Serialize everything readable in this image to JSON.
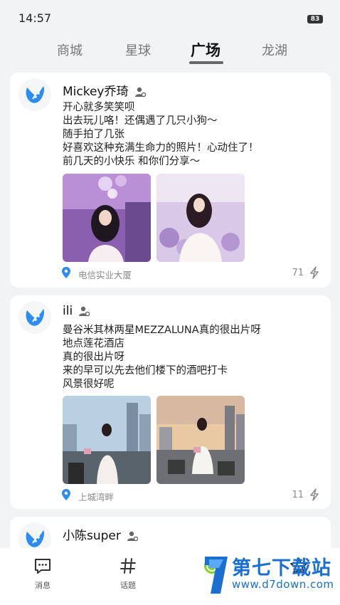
{
  "status_bar": {
    "time": "14:57",
    "battery": "83"
  },
  "tabs": [
    {
      "label": "商城",
      "active": false
    },
    {
      "label": "星球",
      "active": false
    },
    {
      "label": "广场",
      "active": true
    },
    {
      "label": "龙湖",
      "active": false
    }
  ],
  "posts": [
    {
      "username": "Mickey乔琦",
      "lines": [
        "开心就多笑笑呗",
        "出去玩儿咯！还偶遇了几只小狗～",
        "随手拍了几张",
        "好喜欢这种充满生命力的照片！心动住了！",
        "前几天的小快乐 和你们分享～"
      ],
      "location": "电信实业大厦",
      "likes": "71"
    },
    {
      "username": "ili",
      "lines": [
        "曼谷米其林两星MEZZALUNA真的很出片呀",
        "地点莲花酒店",
        "真的很出片呀",
        "来的早可以先去他们楼下的酒吧打卡",
        "风景很好呢"
      ],
      "location": "上城湾畔",
      "likes": "11"
    },
    {
      "username": "小陈super"
    }
  ],
  "bottom_nav": [
    {
      "label": "消息",
      "icon": "message-icon"
    },
    {
      "label": "话题",
      "icon": "hashtag-icon"
    },
    {
      "label": "",
      "icon": "swirl-icon"
    },
    {
      "label": "",
      "icon": "star-face-icon"
    }
  ],
  "watermark": {
    "title": "第七下载站",
    "url": "www.d7down.com"
  },
  "colors": {
    "accent": "#1a6fd1",
    "avatar_blue": "#2d8cf0",
    "background": "#f2f3f5"
  }
}
